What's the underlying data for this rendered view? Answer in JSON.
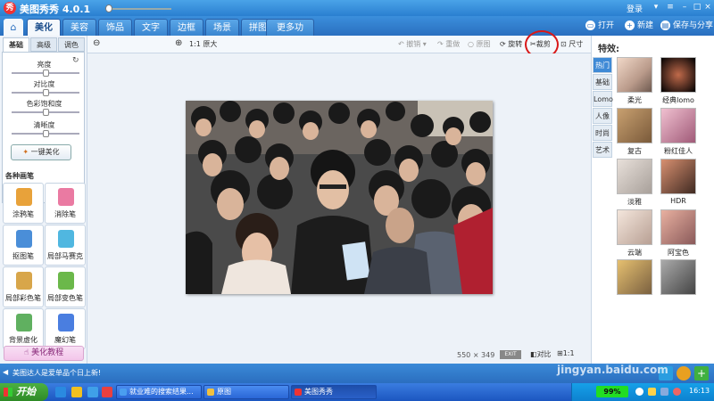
{
  "app": {
    "title": "美图秀秀 4.0.1",
    "login": "登录"
  },
  "menu": {
    "tabs": [
      "美化",
      "美容",
      "饰品",
      "文字",
      "边框",
      "场景",
      "拼图",
      "更多功能"
    ],
    "open": "打开",
    "new": "新建",
    "save_share": "保存与分享"
  },
  "toolbar": {
    "actual_size": "1:1 原大",
    "undo": "撤销",
    "redo": "重做",
    "original": "原图",
    "rotate": "旋转",
    "crop": "裁剪",
    "resize": "尺寸"
  },
  "left_panel": {
    "tabs": [
      "基础",
      "高级",
      "调色"
    ],
    "sliders": [
      {
        "label": "亮度",
        "value": 0.5
      },
      {
        "label": "对比度",
        "value": 0.5
      },
      {
        "label": "色彩饱和度",
        "value": 0.5
      },
      {
        "label": "清晰度",
        "value": 0.5
      }
    ],
    "onekey": "一键美化",
    "brushes_title": "各种画笔",
    "brushes": [
      {
        "label": "涂鸦笔",
        "color": "#e8a23a"
      },
      {
        "label": "消除笔",
        "color": "#ea7aa2"
      },
      {
        "label": "抠图笔",
        "color": "#4a8ed8"
      },
      {
        "label": "局部马赛克",
        "color": "#50b7e0"
      },
      {
        "label": "局部彩色笔",
        "color": "#d8a64a"
      },
      {
        "label": "局部变色笔",
        "color": "#6bb84a"
      },
      {
        "label": "背景虚化",
        "color": "#60b060"
      },
      {
        "label": "魔幻笔",
        "color": "#4a7ee0"
      }
    ],
    "course": "美化教程"
  },
  "canvas": {
    "dims": "550 × 349",
    "exit": "EXIT",
    "compare": "对比",
    "fit": "1:1"
  },
  "right_panel": {
    "title": "特效:",
    "tabs": [
      "热门",
      "基础",
      "Lomo",
      "人像",
      "时尚",
      "艺术"
    ],
    "effects": [
      "柔光",
      "经典lomo",
      "复古",
      "粉红佳人",
      "淡雅",
      "HDR",
      "云端",
      "阿宝色"
    ]
  },
  "infobar": {
    "text": "美图达人是爱单品个日上新!"
  },
  "taskbar": {
    "start": "开始",
    "tasks": [
      "就业难的搜索结果...",
      "原图",
      "美图秀秀"
    ],
    "battery": "99%",
    "time": "16:13"
  },
  "watermark": "jingyan.baidu.com",
  "colors": {
    "accent": "#2a7fd0",
    "highlight_circle": "#d81818"
  }
}
